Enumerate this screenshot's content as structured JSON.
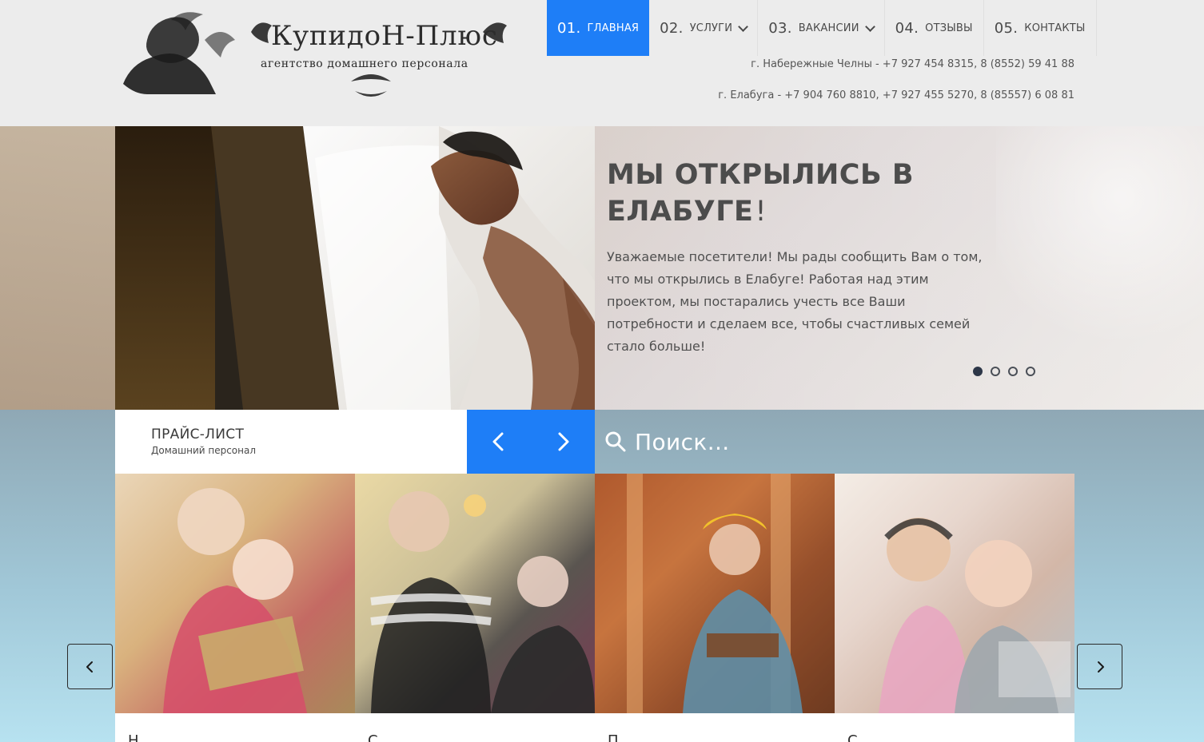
{
  "brand": {
    "name": "КупидоН-Плюс",
    "tagline": "агентство домашнего персонала"
  },
  "nav": {
    "items": [
      {
        "num": "01.",
        "label": "главная",
        "active": true
      },
      {
        "num": "02.",
        "label": "услуги",
        "dropdown": true
      },
      {
        "num": "03.",
        "label": "вакансии",
        "dropdown": true
      },
      {
        "num": "04.",
        "label": "отзывы"
      },
      {
        "num": "05.",
        "label": "контакты"
      }
    ]
  },
  "contacts": {
    "line1": "г. Набережные Челны - +7 927 454 8315, 8 (8552) 59 41 88",
    "line2": "г. Елабуга - +7 904 760 8810, +7 927 455 5270, 8 (85557) 6 08 81"
  },
  "hero": {
    "title": "МЫ ОТКРЫЛИСЬ В ЕЛАБУГЕ",
    "title_suffix": "!",
    "description": "Уважаемые посетители! Мы рады сообщить Вам о том, что мы открылись в Елабуге! Работая над этим проектом, мы постарались учесть все Ваши потребности и сделаем все, чтобы счастливых семей стало больше!",
    "dots": [
      true,
      false,
      false,
      false
    ]
  },
  "price": {
    "title": "ПРАЙС-ЛИСТ",
    "subtitle": "Домашний персонал"
  },
  "search": {
    "placeholder": "Поиск..."
  },
  "cards": [
    {
      "title": "Н",
      "icon": "nanny-photo"
    },
    {
      "title": "С",
      "icon": "caregiver-photo"
    },
    {
      "title": "П",
      "icon": "worker-photo"
    },
    {
      "title": "С",
      "icon": "couple-photo"
    }
  ],
  "colors": {
    "accent": "#1e7ef7",
    "header_bg": "#ececec",
    "lower_gradient_top": "#8fa8b5",
    "lower_gradient_bottom": "#b7e2f0"
  }
}
